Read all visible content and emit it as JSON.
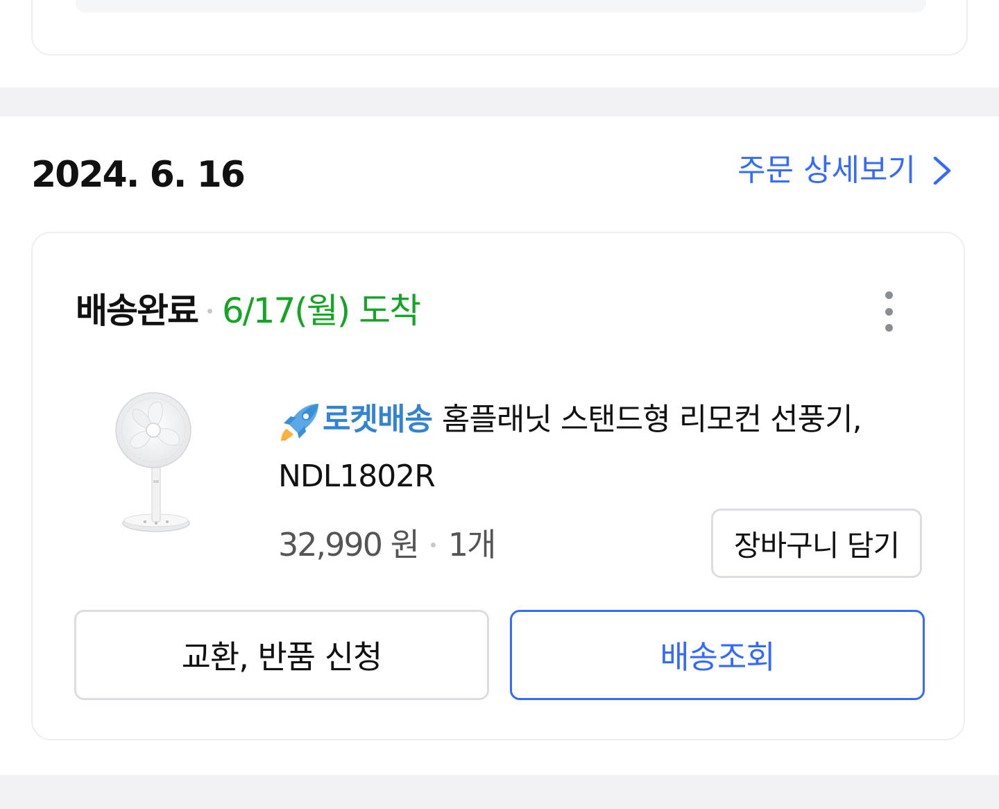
{
  "order": {
    "date": "2024. 6. 16",
    "detail_link_label": "주문 상세보기",
    "status": "배송완료",
    "arrival": "6/17(월) 도착",
    "product": {
      "badge_label": "로켓배송",
      "name": "홈플래닛 스탠드형 리모컨 선풍기, NDL1802R",
      "price": "32,990 원",
      "quantity": "1개"
    },
    "buttons": {
      "cart": "장바구니 담기",
      "return": "교환, 반품 신청",
      "track": "배송조회"
    }
  },
  "icons": {
    "chevron": "chevron-right-icon",
    "more": "more-vertical-icon",
    "rocket": "rocket-icon",
    "product_image": "stand-fan-image"
  },
  "colors": {
    "accent_blue": "#346aff",
    "arrival_green": "#13a523",
    "rocket_blue": "#3283d6",
    "section_gap": "#f2f2f4"
  }
}
